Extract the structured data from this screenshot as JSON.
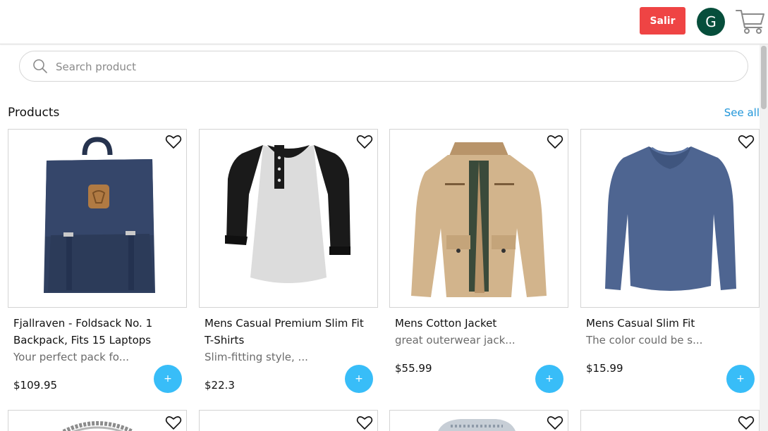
{
  "header": {
    "logout_label": "Salir",
    "avatar_initial": "G",
    "logout_color": "#ef4444",
    "avatar_color": "#064e3b"
  },
  "search": {
    "placeholder": "Search product",
    "value": ""
  },
  "section": {
    "title": "Products",
    "see_all": "See all"
  },
  "add_button_label": "+",
  "add_button_color": "#38bdf8",
  "products": [
    {
      "title": "Fjallraven - Foldsack No. 1 Backpack, Fits 15 Laptops",
      "description": "Your perfect pack fo...",
      "price": "$109.95",
      "image": "navy-backpack"
    },
    {
      "title": "Mens Casual Premium Slim Fit T-Shirts",
      "description": "Slim-fitting style, ...",
      "price": "$22.3",
      "image": "raglan-henley-tshirt"
    },
    {
      "title": "Mens Cotton Jacket",
      "description": "great outerwear jack...",
      "price": "$55.99",
      "image": "khaki-cotton-jacket"
    },
    {
      "title": "Mens Casual Slim Fit",
      "description": "The color could be s...",
      "price": "$15.99",
      "image": "blue-long-sleeve-shirt"
    }
  ],
  "second_row_images": [
    "silver-chain-bracelet",
    "blank",
    "silver-ring",
    "blank"
  ]
}
